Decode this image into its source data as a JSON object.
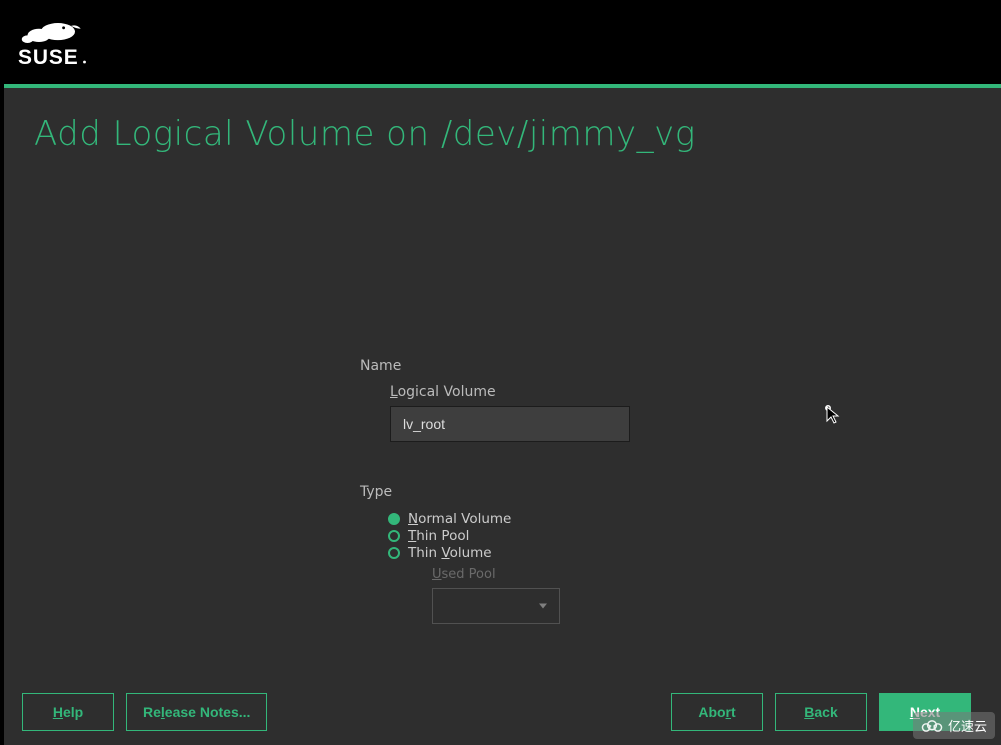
{
  "brand": "SUSE",
  "page": {
    "title": "Add Logical Volume on /dev/jimmy_vg"
  },
  "form": {
    "name_group_label": "Name",
    "lv_label": "Logical Volume",
    "lv_value": "lv_root",
    "type_group_label": "Type",
    "type_options": {
      "normal": "Normal Volume",
      "thin_pool": "Thin Pool",
      "thin_volume": "Thin Volume"
    },
    "used_pool_label": "Used Pool",
    "used_pool_value": ""
  },
  "footer": {
    "help": "Help",
    "release_notes": "Release Notes...",
    "abort": "Abort",
    "back": "Back",
    "next": "Next"
  },
  "watermark": "亿速云"
}
